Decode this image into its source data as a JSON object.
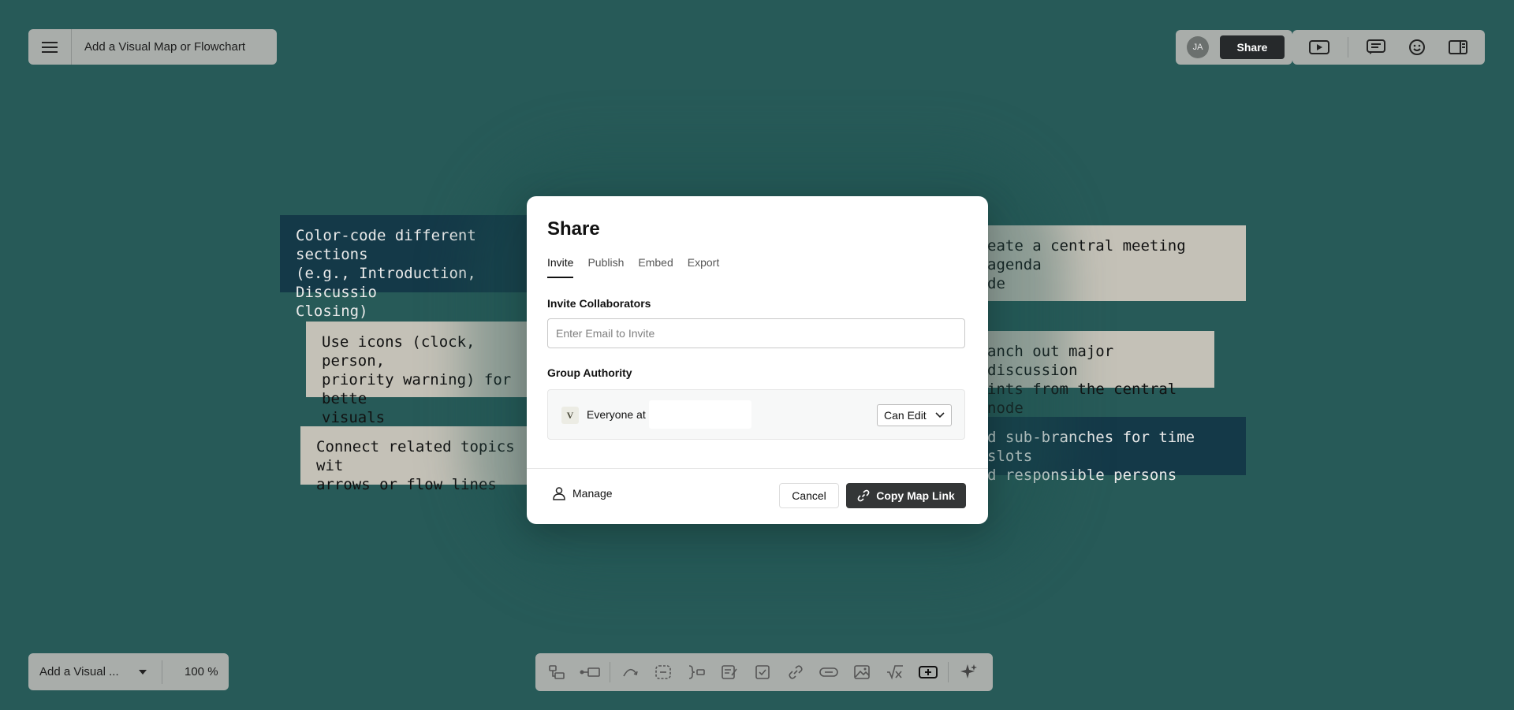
{
  "app": {
    "title": "Add a Visual Map or Flowchart",
    "avatar_initials": "JA",
    "share_label": "Share"
  },
  "right_tools": [
    "present-icon",
    "comment-icon",
    "emoji-icon",
    "sidebar-icon"
  ],
  "notes": [
    {
      "lines": [
        "Color-code different sections",
        "(e.g., Introduction, Discussio",
        "Closing)"
      ],
      "style": "dark"
    },
    {
      "lines": [
        "Use icons (clock, person,",
        "priority warning) for bette",
        "visuals"
      ],
      "style": "light"
    },
    {
      "lines": [
        "Connect related topics wit",
        "arrows or flow lines"
      ],
      "style": "light"
    },
    {
      "lines": [
        "eate a central meeting agenda",
        "de"
      ],
      "style": "light"
    },
    {
      "lines": [
        "anch out major discussion",
        "ints from the central node"
      ],
      "style": "light"
    },
    {
      "lines": [
        "d sub-branches for time slots",
        "d responsible persons"
      ],
      "style": "dark"
    }
  ],
  "dialog": {
    "title": "Share",
    "tabs": [
      "Invite",
      "Publish",
      "Embed",
      "Export"
    ],
    "active_tab": "Invite",
    "invite_label": "Invite Collaborators",
    "email_placeholder": "Enter Email to Invite",
    "email_value": "",
    "group_label": "Group Authority",
    "group_logo": "V",
    "group_text": "Everyone at",
    "permission": "Can Edit",
    "manage_label": "Manage",
    "cancel_label": "Cancel",
    "copy_label": "Copy Map Link"
  },
  "bottom": {
    "map_name": "Add a Visual ...",
    "zoom": "100 %"
  },
  "toolbar_icons": [
    "subtopic-icon",
    "sibling-topic-icon",
    "relationship-icon",
    "boundary-icon",
    "summary-icon",
    "note-icon",
    "task-icon",
    "hyperlink-icon",
    "link-icon",
    "image-icon",
    "formula-icon",
    "insert-icon",
    "ai-sparkle-icon"
  ]
}
